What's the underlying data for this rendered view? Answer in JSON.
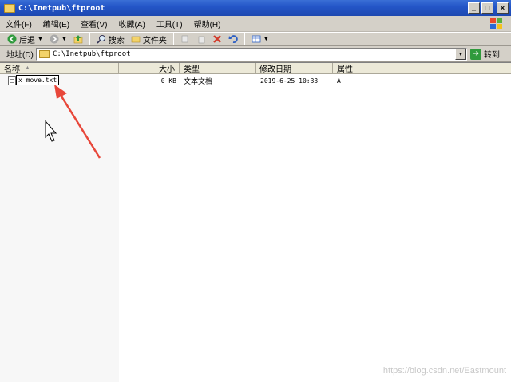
{
  "window": {
    "title": "C:\\Inetpub\\ftproot",
    "buttons": {
      "minimize": "_",
      "maximize": "□",
      "close": "×"
    }
  },
  "menu": {
    "items": [
      {
        "label": "文件(F)"
      },
      {
        "label": "编辑(E)"
      },
      {
        "label": "查看(V)"
      },
      {
        "label": "收藏(A)"
      },
      {
        "label": "工具(T)"
      },
      {
        "label": "帮助(H)"
      }
    ]
  },
  "toolbar": {
    "back_label": "后退",
    "search_label": "搜索",
    "folders_label": "文件夹"
  },
  "address": {
    "label": "地址(D)",
    "value": "C:\\Inetpub\\ftproot",
    "go_label": "转到"
  },
  "columns": {
    "name": "名称",
    "size": "大小",
    "type": "类型",
    "modified": "修改日期",
    "attributes": "属性"
  },
  "files": [
    {
      "name": "x move.txt",
      "size": "0 KB",
      "type": "文本文档",
      "modified": "2019-6-25 10:33",
      "attributes": "A"
    }
  ],
  "watermark": "https://blog.csdn.net/Eastmount",
  "colors": {
    "title_bar": "#2456c8",
    "chrome": "#d4d0c8",
    "arrow": "#e8473a"
  }
}
